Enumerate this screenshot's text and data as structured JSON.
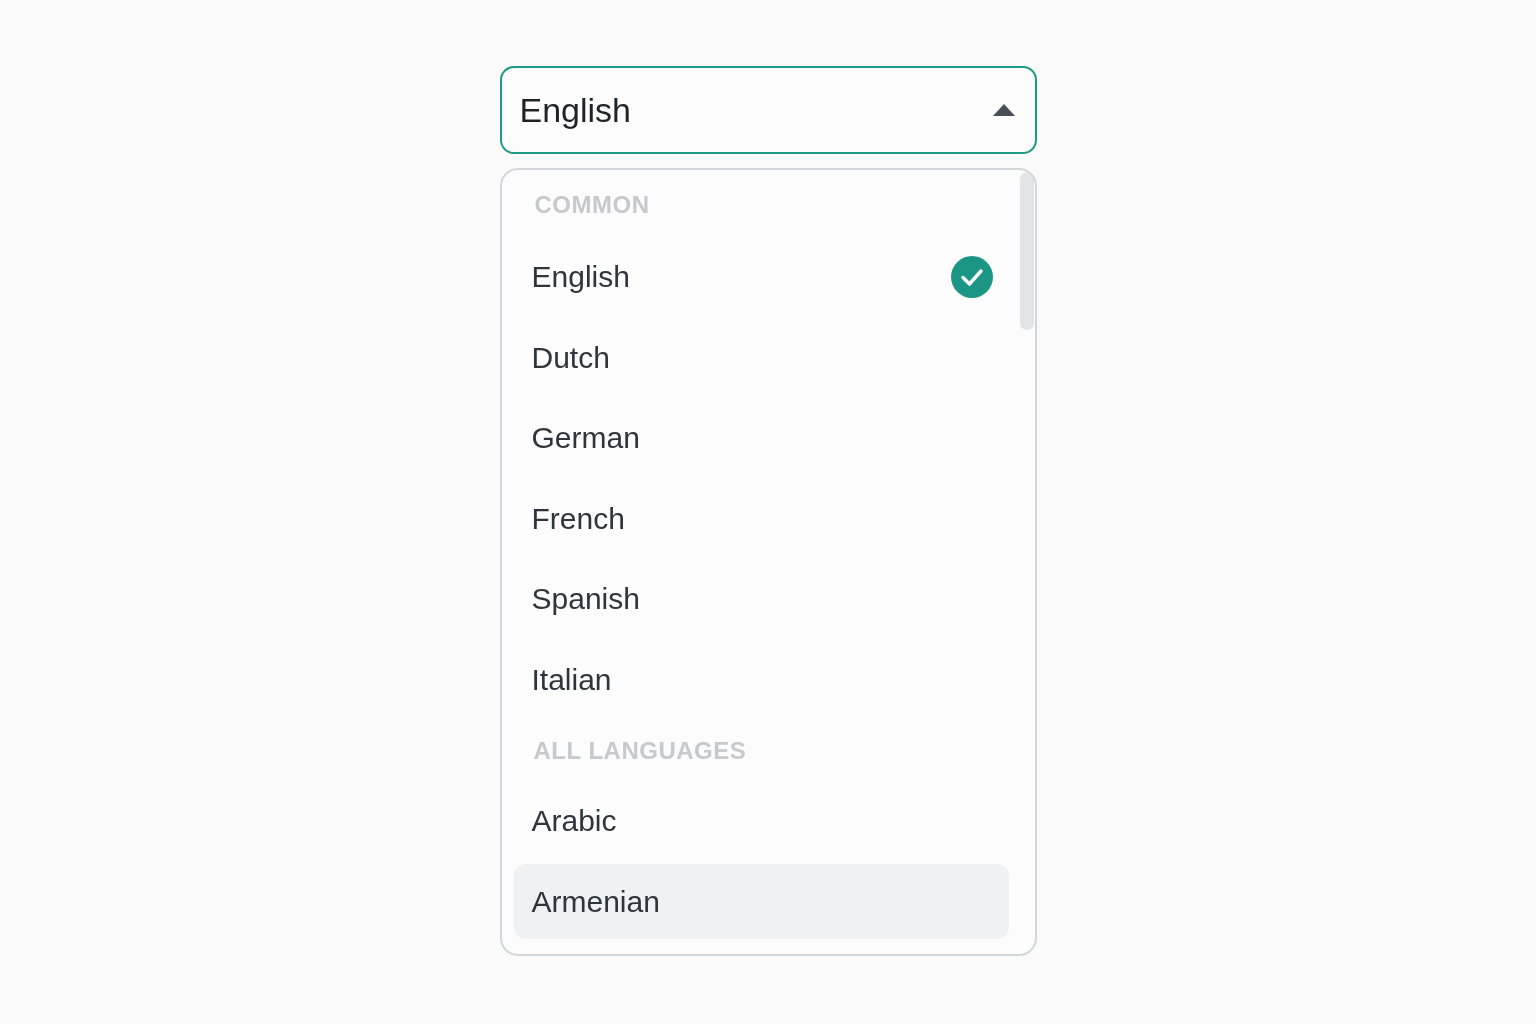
{
  "select": {
    "value": "English",
    "expanded": true
  },
  "dropdown": {
    "groups": [
      {
        "heading": "COMMON",
        "options": [
          {
            "label": "English",
            "selected": true,
            "hovered": false
          },
          {
            "label": "Dutch",
            "selected": false,
            "hovered": false
          },
          {
            "label": "German",
            "selected": false,
            "hovered": false
          },
          {
            "label": "French",
            "selected": false,
            "hovered": false
          },
          {
            "label": "Spanish",
            "selected": false,
            "hovered": false
          },
          {
            "label": "Italian",
            "selected": false,
            "hovered": false
          }
        ]
      },
      {
        "heading": "ALL LANGUAGES",
        "options": [
          {
            "label": "Arabic",
            "selected": false,
            "hovered": false
          },
          {
            "label": "Armenian",
            "selected": false,
            "hovered": true
          }
        ]
      }
    ]
  }
}
